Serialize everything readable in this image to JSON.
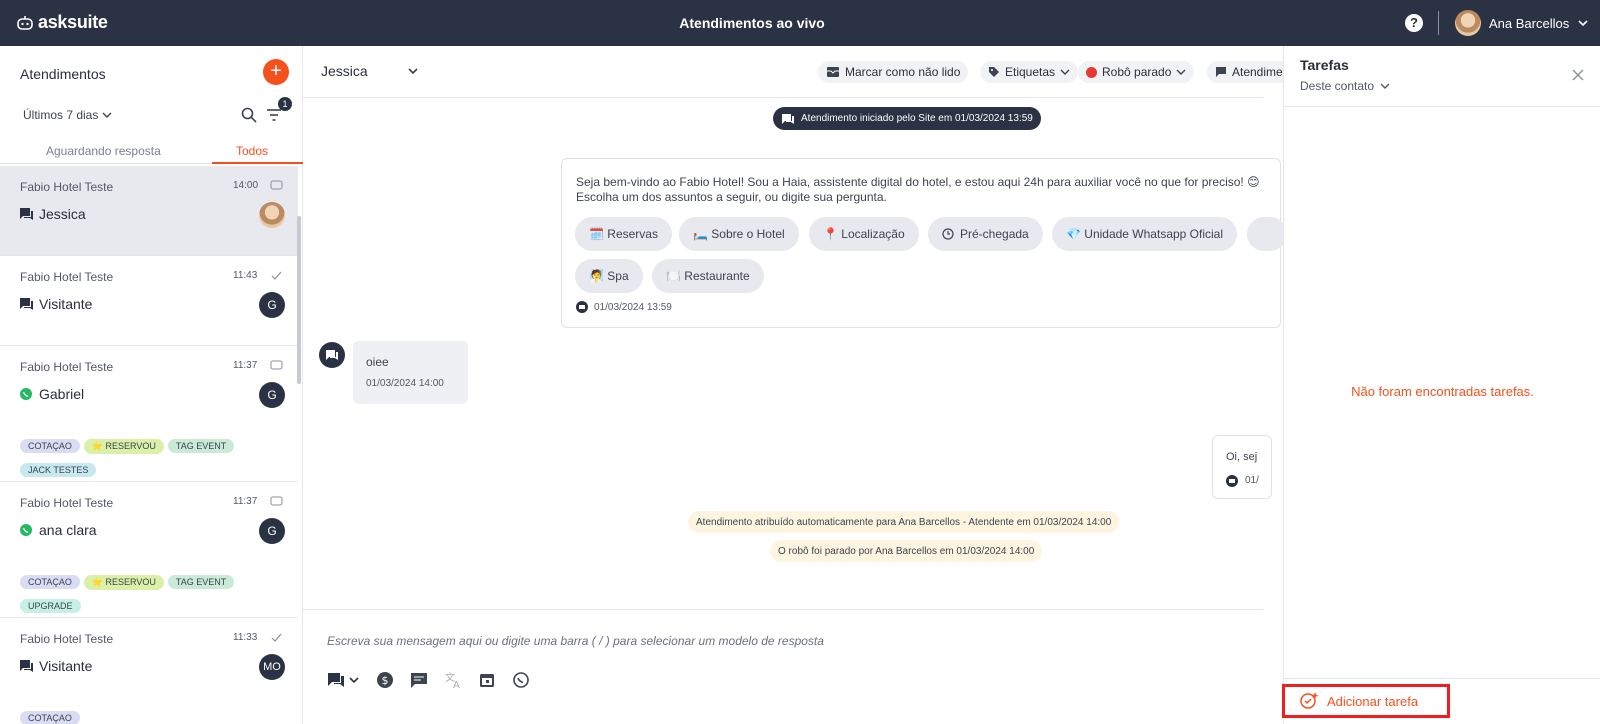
{
  "app": {
    "brand": "asksuite",
    "title": "Atendimentos ao vivo",
    "user": "Ana Barcellos"
  },
  "sidebar": {
    "title": "Atendimentos",
    "period": "Últimos 7 dias",
    "filter_count": "1",
    "tabs": [
      {
        "label": "Aguardando resposta"
      },
      {
        "label": "Todos"
      }
    ],
    "items": [
      {
        "hotel": "Fabio Hotel Teste",
        "time": "14:00",
        "name": "Jessica",
        "avatar": ""
      },
      {
        "hotel": "Fabio Hotel Teste",
        "time": "11:43",
        "name": "Visitante",
        "avatar": "G"
      },
      {
        "hotel": "Fabio Hotel Teste",
        "time": "11:37",
        "name": "Gabriel",
        "avatar": "G",
        "tags": [
          "COTAÇAO",
          "⭐ RESERVOU",
          "TAG EVENT",
          "JACK TESTES"
        ]
      },
      {
        "hotel": "Fabio Hotel Teste",
        "time": "11:37",
        "name": "ana clara",
        "avatar": "G",
        "tags": [
          "COTAÇAO",
          "⭐ RESERVOU",
          "TAG EVENT",
          "UPGRADE"
        ]
      },
      {
        "hotel": "Fabio Hotel Teste",
        "time": "11:33",
        "name": "Visitante",
        "avatar": "MO",
        "tags": [
          "COTAÇAO"
        ]
      }
    ]
  },
  "chat": {
    "contact": "Jessica",
    "actions": {
      "unread": "Marcar como não lido",
      "tags": "Etiquetas",
      "robot": "Robô parado",
      "attend": "Atendime"
    },
    "started": "Atendimento iniciado pelo Site em 01/03/2024 13:59",
    "bot": {
      "line1": "Seja bem-vindo ao Fabio Hotel! Sou a Haia, assistente digital do hotel, e estou aqui 24h para auxiliar você no que for preciso! 😊",
      "line2": "Escolha um dos assuntos a seguir, ou digite sua pergunta.",
      "chips": [
        "🗓️ Reservas",
        "🛏️ Sobre o Hotel",
        "📍 Localização",
        "Pré-chegada",
        "💎 Unidade Whatsapp Oficial",
        "🧖 Spa",
        "🍽️ Restaurante"
      ],
      "time": "01/03/2024 13:59"
    },
    "user_msg": {
      "text": "oiee",
      "time": "01/03/2024 14:00"
    },
    "agent_msg": {
      "text": "Oi, sej",
      "time": "01/"
    },
    "notes": [
      "Atendimento atribuído automaticamente para Ana Barcellos - Atendente em 01/03/2024 14:00",
      "O robô foi parado por Ana Barcellos em 01/03/2024 14:00"
    ],
    "placeholder": "Escreva sua mensagem aqui ou digite uma barra ( / ) para selecionar um modelo de resposta"
  },
  "tasks": {
    "title": "Tarefas",
    "filter": "Deste contato",
    "empty": "Não foram encontradas tarefas.",
    "add": "Adicionar tarefa"
  },
  "colors": {
    "accent": "#f4511e",
    "header": "#2a3243",
    "highlight": "#f01e1e"
  }
}
